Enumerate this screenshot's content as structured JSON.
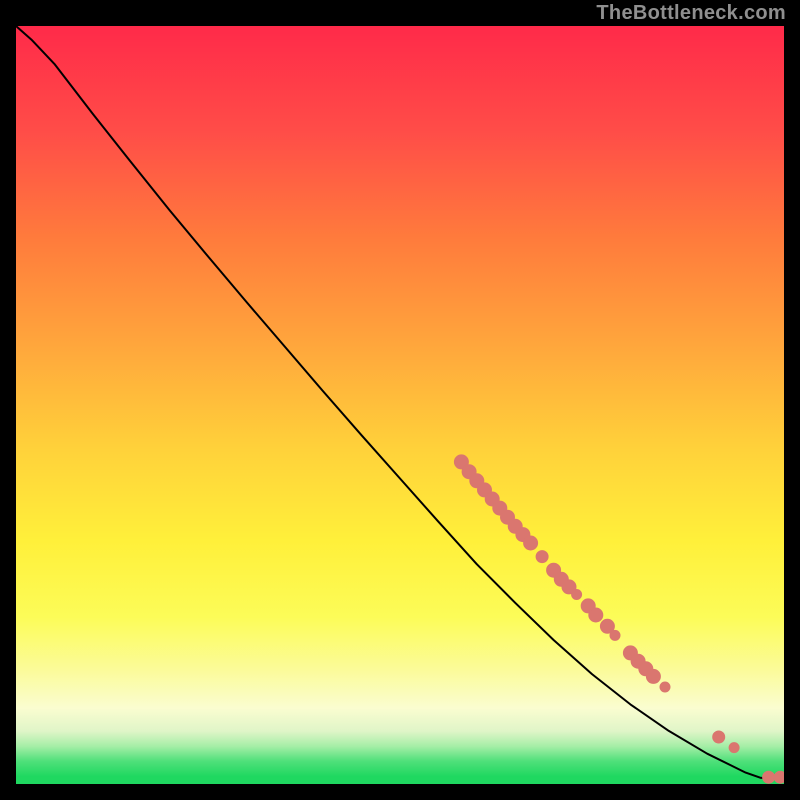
{
  "watermark": "TheBottleneck.com",
  "colors": {
    "curve": "#000000",
    "point_fill": "#da766f",
    "point_stroke": "#da766f"
  },
  "chart_data": {
    "type": "line",
    "title": "",
    "xlabel": "",
    "ylabel": "",
    "xlim": [
      0,
      100
    ],
    "ylim": [
      0,
      100
    ],
    "grid": false,
    "legend": false,
    "curve": [
      {
        "x": 0,
        "y": 100
      },
      {
        "x": 2,
        "y": 98.2
      },
      {
        "x": 5,
        "y": 95.0
      },
      {
        "x": 10,
        "y": 88.4
      },
      {
        "x": 15,
        "y": 82.0
      },
      {
        "x": 20,
        "y": 75.7
      },
      {
        "x": 25,
        "y": 69.6
      },
      {
        "x": 30,
        "y": 63.6
      },
      {
        "x": 35,
        "y": 57.7
      },
      {
        "x": 40,
        "y": 51.8
      },
      {
        "x": 45,
        "y": 46.0
      },
      {
        "x": 50,
        "y": 40.3
      },
      {
        "x": 55,
        "y": 34.6
      },
      {
        "x": 60,
        "y": 29.0
      },
      {
        "x": 65,
        "y": 23.9
      },
      {
        "x": 70,
        "y": 19.0
      },
      {
        "x": 75,
        "y": 14.5
      },
      {
        "x": 80,
        "y": 10.5
      },
      {
        "x": 85,
        "y": 7.0
      },
      {
        "x": 90,
        "y": 4.0
      },
      {
        "x": 93,
        "y": 2.5
      },
      {
        "x": 95,
        "y": 1.5
      },
      {
        "x": 97,
        "y": 0.8
      },
      {
        "x": 98,
        "y": 0.8
      },
      {
        "x": 99,
        "y": 0.8
      },
      {
        "x": 100,
        "y": 0.8
      }
    ],
    "points": [
      {
        "x": 58.0,
        "y": 42.5,
        "r": 7
      },
      {
        "x": 59.0,
        "y": 41.2,
        "r": 7
      },
      {
        "x": 60.0,
        "y": 40.0,
        "r": 7
      },
      {
        "x": 61.0,
        "y": 38.8,
        "r": 7
      },
      {
        "x": 62.0,
        "y": 37.6,
        "r": 7
      },
      {
        "x": 63.0,
        "y": 36.4,
        "r": 7
      },
      {
        "x": 64.0,
        "y": 35.2,
        "r": 7
      },
      {
        "x": 65.0,
        "y": 34.0,
        "r": 7
      },
      {
        "x": 66.0,
        "y": 32.9,
        "r": 7
      },
      {
        "x": 67.0,
        "y": 31.8,
        "r": 7
      },
      {
        "x": 68.5,
        "y": 30.0,
        "r": 6
      },
      {
        "x": 70.0,
        "y": 28.2,
        "r": 7
      },
      {
        "x": 71.0,
        "y": 27.0,
        "r": 7
      },
      {
        "x": 72.0,
        "y": 26.0,
        "r": 7
      },
      {
        "x": 73.0,
        "y": 25.0,
        "r": 5
      },
      {
        "x": 74.5,
        "y": 23.5,
        "r": 7
      },
      {
        "x": 75.5,
        "y": 22.3,
        "r": 7
      },
      {
        "x": 77.0,
        "y": 20.8,
        "r": 7
      },
      {
        "x": 78.0,
        "y": 19.6,
        "r": 5
      },
      {
        "x": 80.0,
        "y": 17.3,
        "r": 7
      },
      {
        "x": 81.0,
        "y": 16.2,
        "r": 7
      },
      {
        "x": 82.0,
        "y": 15.2,
        "r": 7
      },
      {
        "x": 83.0,
        "y": 14.2,
        "r": 7
      },
      {
        "x": 84.5,
        "y": 12.8,
        "r": 5
      },
      {
        "x": 91.5,
        "y": 6.2,
        "r": 6
      },
      {
        "x": 93.5,
        "y": 4.8,
        "r": 5
      },
      {
        "x": 98.0,
        "y": 0.9,
        "r": 6
      },
      {
        "x": 99.5,
        "y": 0.9,
        "r": 6
      }
    ]
  }
}
